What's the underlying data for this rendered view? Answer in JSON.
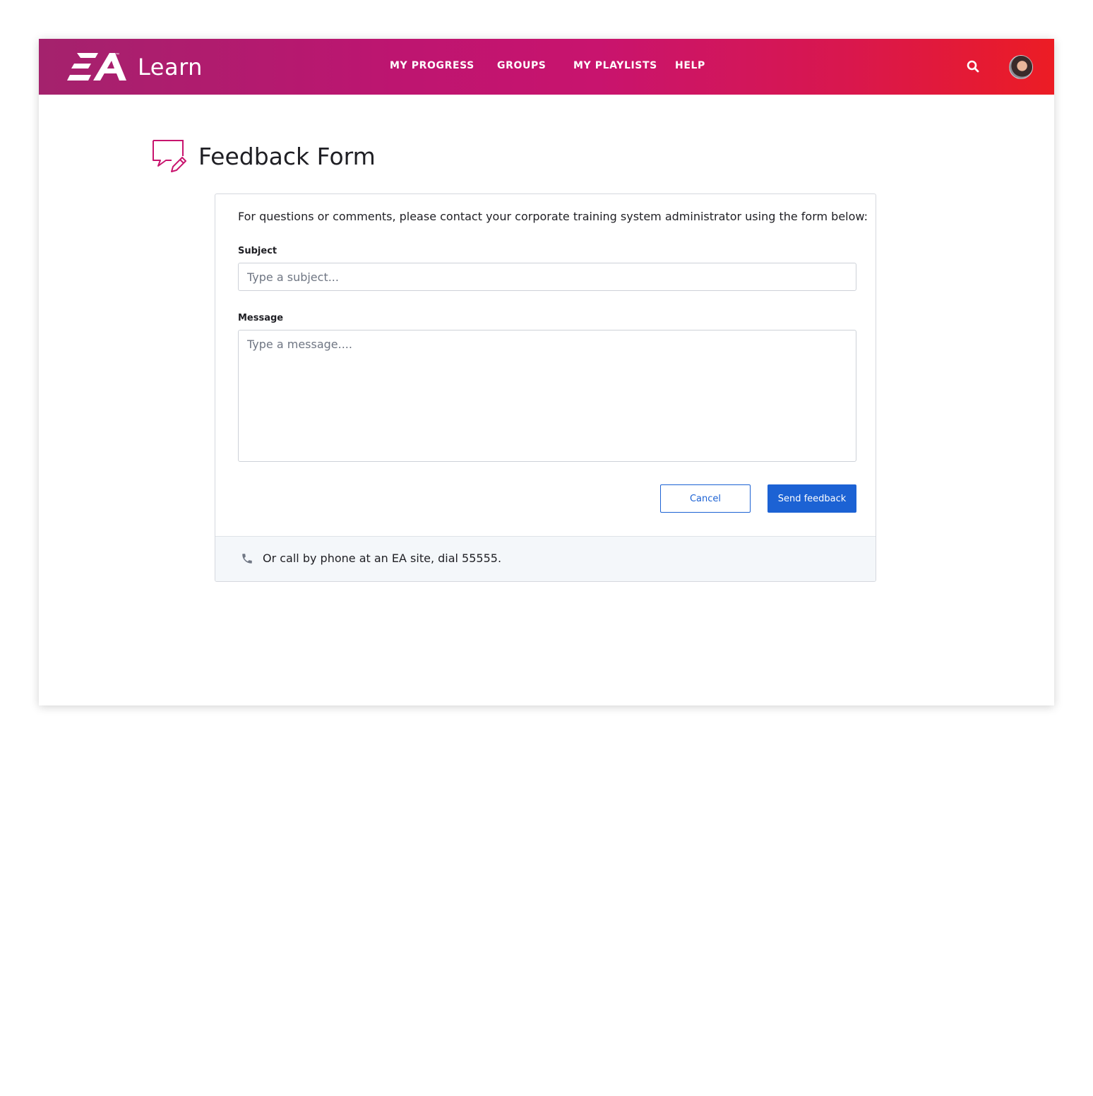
{
  "app": {
    "brand_text": "Learn",
    "trademark": "™",
    "colors": {
      "header_start": "#a4226d",
      "header_end": "#ec1c24",
      "accent": "#c8146e",
      "primary_button": "#1c62d4"
    }
  },
  "nav": {
    "items": [
      {
        "label": "MY PROGRESS"
      },
      {
        "label": "GROUPS"
      },
      {
        "label": "MY PLAYLISTS"
      },
      {
        "label": "HELP"
      }
    ],
    "search_icon": "search-icon",
    "avatar": "user-avatar"
  },
  "page": {
    "title": "Feedback Form",
    "icon": "feedback-edit-icon"
  },
  "form": {
    "intro": "For questions or comments, please contact your corporate training system administrator using the form below:",
    "subject": {
      "label": "Subject",
      "placeholder": "Type a subject...",
      "value": ""
    },
    "message": {
      "label": "Message",
      "placeholder": "Type a message....",
      "value": ""
    },
    "cancel_label": "Cancel",
    "send_label": "Send feedback"
  },
  "footer": {
    "icon": "phone-icon",
    "text": "Or call by phone at an EA site, dial 55555."
  }
}
